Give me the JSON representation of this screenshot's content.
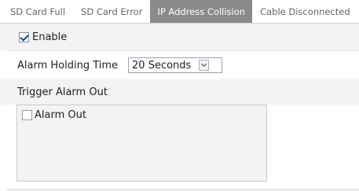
{
  "tabs": [
    {
      "label": "SD Card Full",
      "active": false
    },
    {
      "label": "SD Card Error",
      "active": false
    },
    {
      "label": "IP Address Collision",
      "active": true
    },
    {
      "label": "Cable Disconnected",
      "active": false
    }
  ],
  "enable": {
    "label": "Enable",
    "checked": true
  },
  "alarm_holding_time": {
    "label": "Alarm Holding Time",
    "value": "20 Seconds"
  },
  "trigger_alarm_out": {
    "label": "Trigger Alarm Out",
    "items": [
      {
        "label": "Alarm Out",
        "checked": false
      }
    ]
  },
  "colors": {
    "active_tab_bg": "#8a8a8a",
    "row_bg": "#f3f3f3"
  }
}
